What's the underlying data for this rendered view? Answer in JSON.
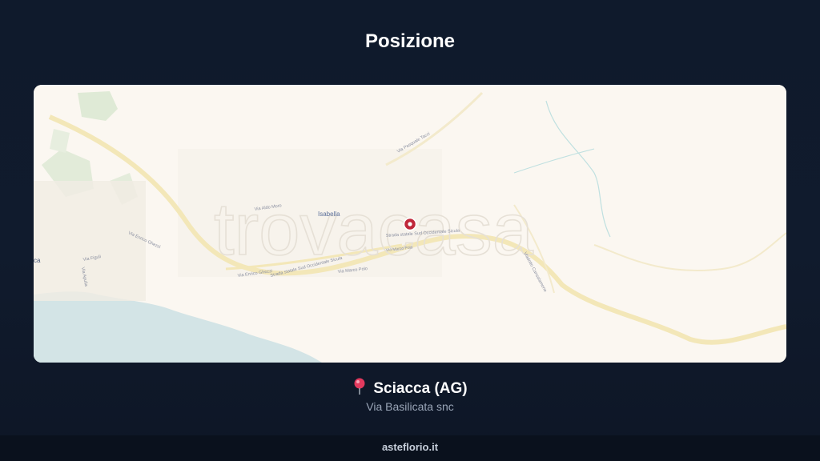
{
  "header": {
    "title": "Posizione"
  },
  "map": {
    "watermark": "trovacasa",
    "places": {
      "isabella": "Isabella",
      "via_aldo_moro": "Via Aldo Moro",
      "via_pasquale_tacci": "Via Pasquale Tacci",
      "via_enrico_ghezzi": "Via Enrico Ghezzi",
      "via_enrico_ghezzi_2": "Via Enrico Ghezzi",
      "ss_sud_occidentale": "Strada statale Sud Occidentale Sicula",
      "ss_sud_occidentale_2": "Strada statale Sud Occidentale Sicula",
      "via_marco_polo": "Via Marco Polo",
      "via_marco_polo_2": "Via Marco Polo",
      "viadotto": "Viadotto Cansalamone",
      "via_fignoli": "Via Figuli",
      "via_apulia": "Via Apulia",
      "ca_partial": "ca"
    },
    "colors": {
      "land": "#fbf7f1",
      "sea": "#cfe3e6",
      "green": "#dbe8d2",
      "road": "#f6ecc4",
      "marker": "#c0283a"
    }
  },
  "location": {
    "city": "Sciacca (AG)",
    "address": "Via Basilicata snc",
    "icon": "round-pushpin-icon"
  },
  "footer": {
    "site": "asteflorio.it"
  }
}
